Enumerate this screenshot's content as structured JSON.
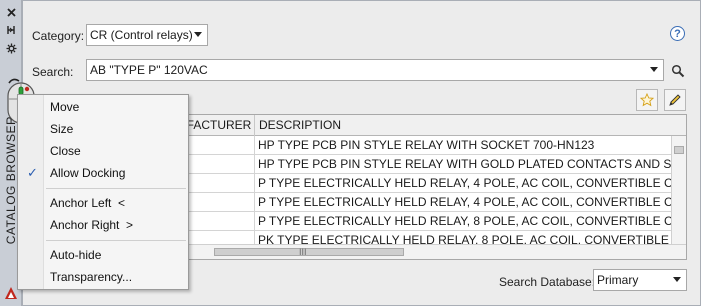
{
  "palette": {
    "accent": "#3a6db5",
    "brand_red": "#c0281e"
  },
  "strip": {
    "title": "CATALOG BROWSER",
    "icons": [
      "close-icon",
      "pin-icon",
      "settings-icon",
      "autodesk-logo-icon"
    ]
  },
  "category": {
    "label": "Category:",
    "value": "CR (Control relays)"
  },
  "search": {
    "label": "Search:",
    "value": "AB \"TYPE P\" 120VAC"
  },
  "grid": {
    "columns": [
      "UFACTURER",
      "DESCRIPTION"
    ],
    "rows": [
      {
        "manufacturer": "",
        "description": "HP TYPE PCB PIN STYLE RELAY WITH SOCKET 700-HN123"
      },
      {
        "manufacturer": "",
        "description": "HP TYPE PCB PIN STYLE RELAY WITH GOLD PLATED CONTACTS AND SOCKET 7"
      },
      {
        "manufacturer": "",
        "description": "P TYPE ELECTRICALLY HELD RELAY, 4 POLE, AC COIL, CONVERTIBLE CONTACTS"
      },
      {
        "manufacturer": "",
        "description": "P TYPE ELECTRICALLY HELD RELAY, 4 POLE, AC COIL, CONVERTIBLE CONTACTS"
      },
      {
        "manufacturer": "",
        "description": "P TYPE ELECTRICALLY HELD RELAY, 8 POLE, AC COIL, CONVERTIBLE CONTACTS"
      },
      {
        "manufacturer": "",
        "description": "PK TYPE ELECTRICALLY HELD RELAY, 8 POLE, AC COIL, CONVERTIBLE CONTACTS"
      }
    ],
    "scroll_grip": "III"
  },
  "database": {
    "label": "Search Database:",
    "value": "Primary"
  },
  "menu": {
    "items": [
      {
        "label": "Move",
        "checked": false
      },
      {
        "label": "Size",
        "checked": false
      },
      {
        "label": "Close",
        "checked": false
      },
      {
        "label": "Allow Docking",
        "checked": true
      },
      {
        "label": "Anchor Left  <",
        "checked": false
      },
      {
        "label": "Anchor Right  >",
        "checked": false
      },
      {
        "label": "Auto-hide",
        "checked": false
      },
      {
        "label": "Transparency...",
        "checked": false
      }
    ],
    "check_glyph": "✓"
  }
}
